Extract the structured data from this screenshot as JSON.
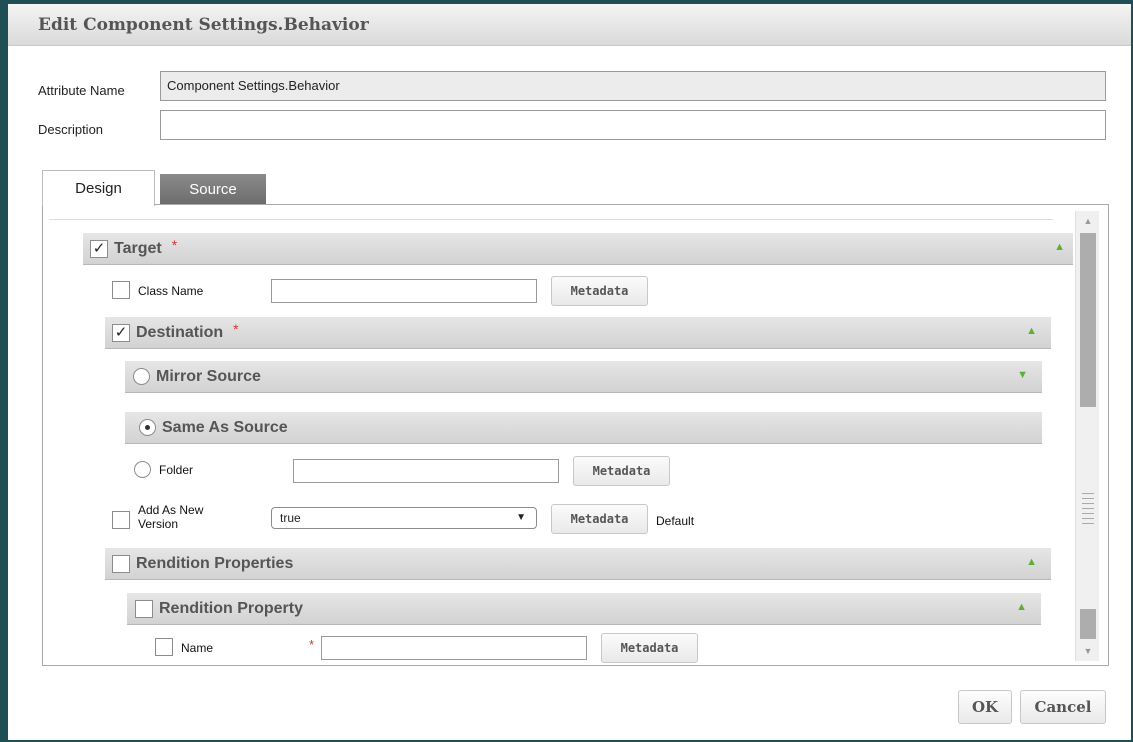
{
  "dialog": {
    "title": "Edit Component Settings.Behavior"
  },
  "form": {
    "attribute_name_label": "Attribute Name",
    "attribute_name_value": "Component Settings.Behavior",
    "description_label": "Description",
    "description_value": ""
  },
  "tabs": [
    {
      "label": "Design",
      "active": true
    },
    {
      "label": "Source",
      "active": false
    }
  ],
  "sections": {
    "target": {
      "label": "Target",
      "checked": true,
      "required": "*"
    },
    "class_name": {
      "label": "Class Name",
      "checked": false,
      "value": "",
      "button": "Metadata"
    },
    "destination": {
      "label": "Destination",
      "checked": true,
      "required": "*"
    },
    "mirror_source": {
      "label": "Mirror Source",
      "selected": false
    },
    "same_as_source": {
      "label": "Same As Source",
      "selected": true
    },
    "folder": {
      "label": "Folder",
      "selected": false,
      "value": "",
      "button": "Metadata"
    },
    "add_as_new_version": {
      "label_line1": "Add As New",
      "label_line2": "Version",
      "checked": false,
      "value": "true",
      "button": "Metadata",
      "note": "Default"
    },
    "rendition_properties": {
      "label": "Rendition Properties",
      "checked": false
    },
    "rendition_property": {
      "label": "Rendition Property",
      "checked": false
    },
    "name": {
      "label": "Name",
      "checked": false,
      "required": "*",
      "value": "",
      "button": "Metadata"
    }
  },
  "icons": {
    "expand_up": "▲",
    "expand_down": "▼",
    "check": "✓"
  },
  "colors": {
    "toggle_arrow": "#5fae3a",
    "required": "#dd3333",
    "dialog_border": "#1f4f55"
  },
  "footer": {
    "ok_label": "OK",
    "cancel_label": "Cancel"
  }
}
